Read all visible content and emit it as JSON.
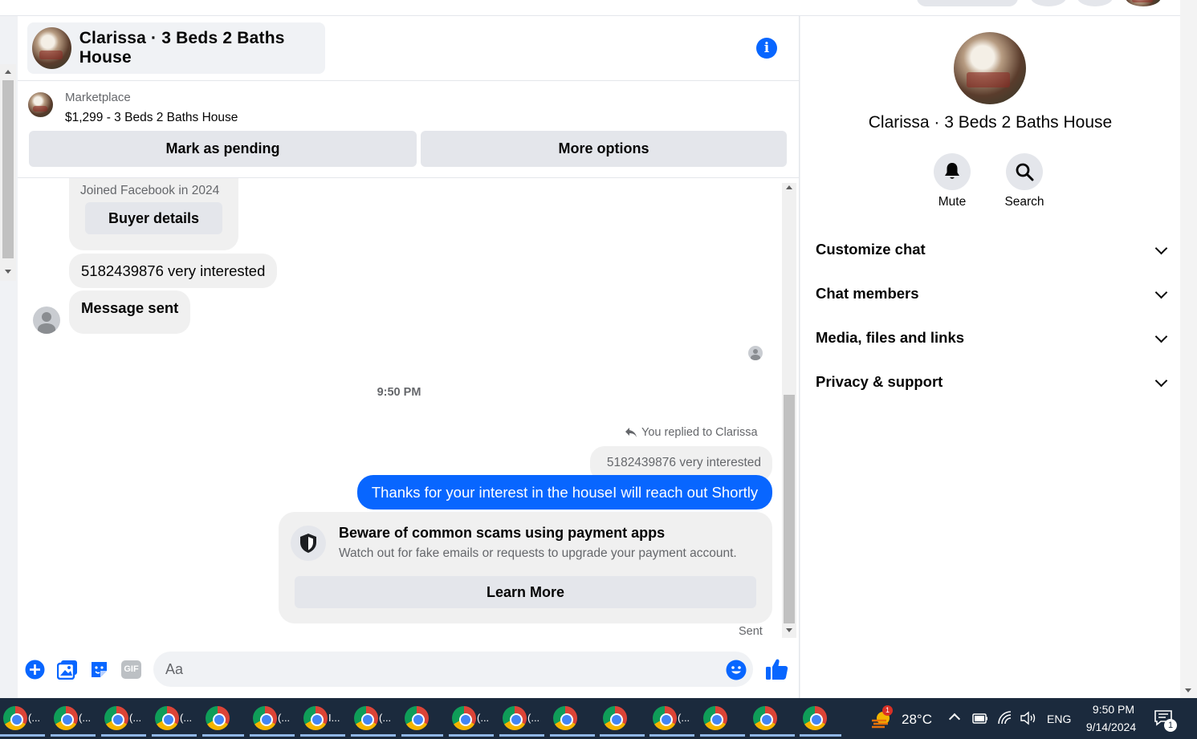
{
  "chat": {
    "title": "Clarissa · 3 Beds 2 Baths House",
    "marketplace_label": "Marketplace",
    "listing": "$1,299 - 3 Beds 2 Baths House",
    "mark_pending": "Mark as pending",
    "more_options": "More options"
  },
  "messages": {
    "joined": "Joined Facebook in 2024",
    "buyer_details": "Buyer details",
    "msg1": "5182439876 very interested",
    "msg2": "Message sent",
    "time": "9:50 PM",
    "replied_to": "You replied to Clarissa",
    "reply_preview": "5182439876 very interested",
    "outgoing": "Thanks for your interest in the houseI will reach out Shortly",
    "scam_title": "Beware of common scams using payment apps",
    "scam_body": "Watch out for fake emails or requests to upgrade your payment account.",
    "learn_more": "Learn More",
    "sent": "Sent"
  },
  "composer": {
    "placeholder": "Aa"
  },
  "sidebar": {
    "title": "Clarissa · 3 Beds 2 Baths House",
    "mute": "Mute",
    "search": "Search",
    "sections": [
      "Customize chat",
      "Chat members",
      "Media, files and links",
      "Privacy & support"
    ]
  },
  "taskbar": {
    "weather": "28°C",
    "weather_badge": "1",
    "language": "ENG",
    "time": "9:50 PM",
    "date": "9/14/2024",
    "notif_count": "1",
    "window_label_short": "(...",
    "window_label_i": "I..."
  },
  "colors": {
    "accent": "#0866ff",
    "bubble_in": "#f0f0f0",
    "taskbar": "#1b2a3d"
  }
}
